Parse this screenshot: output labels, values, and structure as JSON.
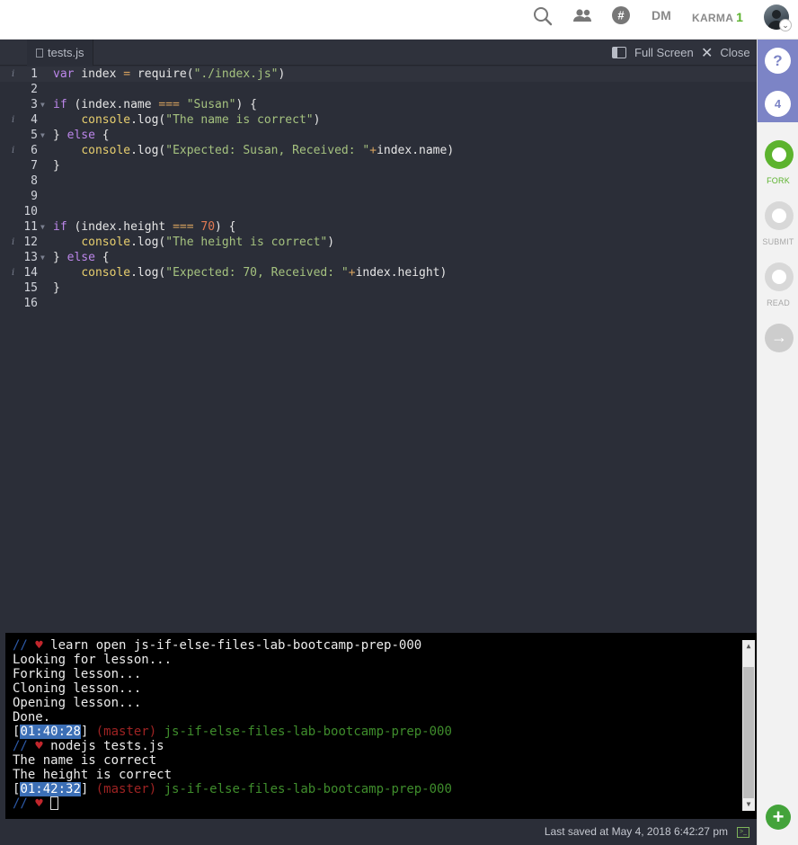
{
  "topbar": {
    "icons": [
      "search-icon",
      "people-icon",
      "slack-icon"
    ],
    "dm_label": "DM",
    "karma_label": "KARMA",
    "karma_value": "1",
    "avatar_badge": "⌄"
  },
  "editor": {
    "tab_label": "tests.js",
    "fullscreen_label": "Full Screen",
    "close_label": "Close",
    "lines": [
      {
        "n": "1",
        "info": true
      },
      {
        "n": "2"
      },
      {
        "n": "3",
        "fold": true
      },
      {
        "n": "4",
        "info": true
      },
      {
        "n": "5",
        "fold": true
      },
      {
        "n": "6",
        "info": true
      },
      {
        "n": "7"
      },
      {
        "n": "8"
      },
      {
        "n": "9"
      },
      {
        "n": "10"
      },
      {
        "n": "11",
        "fold": true
      },
      {
        "n": "12",
        "info": true
      },
      {
        "n": "13",
        "fold": true
      },
      {
        "n": "14",
        "info": true
      },
      {
        "n": "15"
      },
      {
        "n": "16"
      }
    ],
    "code": {
      "l1": {
        "kw": "var",
        "a": " index ",
        "op": "=",
        "b": " require(",
        "str": "\"./index.js\"",
        "c": ")"
      },
      "l3": {
        "kw": "if",
        "a": " (index.name ",
        "op": "===",
        "str": " \"Susan\"",
        "c": ") {"
      },
      "l4": {
        "fn": "console",
        "a": ".log(",
        "str": "\"The name is correct\"",
        "c": ")"
      },
      "l5": {
        "a": "} ",
        "kw": "else",
        "c": " {"
      },
      "l6": {
        "fn": "console",
        "a": ".log(",
        "str": "\"Expected: Susan, Received: \"",
        "op": "+",
        "c": "index.name)"
      },
      "l7": {
        "a": "}"
      },
      "l11": {
        "kw": "if",
        "a": " (index.height ",
        "op": "===",
        "num": " 70",
        "c": ") {"
      },
      "l12": {
        "fn": "console",
        "a": ".log(",
        "str": "\"The height is correct\"",
        "c": ")"
      },
      "l13": {
        "a": "} ",
        "kw": "else",
        "c": " {"
      },
      "l14": {
        "fn": "console",
        "a": ".log(",
        "str": "\"Expected: 70, Received: \"",
        "op": "+",
        "c": "index.height)"
      },
      "l15": {
        "a": "}"
      }
    }
  },
  "terminal": {
    "prompt_slashes": "//",
    "prompt_heart": "♥",
    "cmd1": "learn open js-if-else-files-lab-bootcamp-prep-000",
    "out1": "Looking for lesson...",
    "out2": "Forking lesson...",
    "out3": "Cloning lesson...",
    "out4": "Opening lesson...",
    "out5": "Done.",
    "ts1": "01:40:28",
    "branch": "(master)",
    "repo": "js-if-else-files-lab-bootcamp-prep-000",
    "cmd2": "nodejs tests.js",
    "out6": "The name is correct",
    "out7": "The height is correct",
    "ts2": "01:42:32"
  },
  "statusbar": {
    "saved_text": "Last saved at May 4, 2018 6:42:27 pm",
    "terminal_icon": ">_"
  },
  "sidebar": {
    "help_label": "?",
    "count": "4",
    "fork_label": "FORK",
    "submit_label": "SUBMIT",
    "read_label": "READ",
    "next_label": "→",
    "add_label": "+",
    "colors": {
      "fork": "#5cb32e",
      "inactive": "#d8d8d8",
      "accent": "#7c84c6"
    }
  }
}
